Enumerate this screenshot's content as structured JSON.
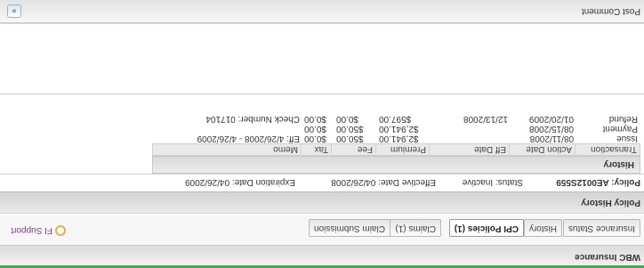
{
  "app": {
    "title": "WBC Insurance"
  },
  "support": {
    "label": "FI Support"
  },
  "tabs": [
    {
      "label": "Insurance Status",
      "active": false
    },
    {
      "label": "History",
      "active": false
    },
    {
      "label": "CPI Policies (1)",
      "active": true
    },
    {
      "label": "Claims (1)",
      "active": false
    },
    {
      "label": "Claim Submission",
      "active": false
    }
  ],
  "policy_history": {
    "section_title": "Policy History",
    "policy_label": "Policy:",
    "policy_id": "AE0012S559",
    "status": "Status: Inactive",
    "effective": "Effective Date: 04/26/2008",
    "expiration": "Expiration Date: 04/26/2009"
  },
  "history": {
    "title": "History",
    "columns": [
      "Transaction",
      "Action Date",
      "Eff Date",
      "Premium",
      "Fee",
      "Tax",
      "Memo"
    ],
    "rows": [
      {
        "transaction": "Issue",
        "action_date": "08/11/2008",
        "eff_date": "",
        "premium": "$2,941.00",
        "fee": "$50.00",
        "tax": "$0.00",
        "memo": "Eff: 4/26/2008 - 4/26/2009"
      },
      {
        "transaction": "Payment",
        "action_date": "08/15/2008",
        "eff_date": "",
        "premium": "$2,941.00",
        "fee": "$50.00",
        "tax": "$0.00",
        "memo": ""
      },
      {
        "transaction": "Refund",
        "action_date": "01/20/2009",
        "eff_date": "12/13/2008",
        "premium": "$597.00",
        "fee": "$0.00",
        "tax": "$0.00",
        "memo": "Check Number: 017104"
      }
    ]
  },
  "comment": {
    "label": "Post Comment",
    "collapse_icon": "double-chevron-up-icon"
  },
  "colors": {
    "accent_green": "#3bb24a",
    "support_text": "#7a3c8a"
  }
}
